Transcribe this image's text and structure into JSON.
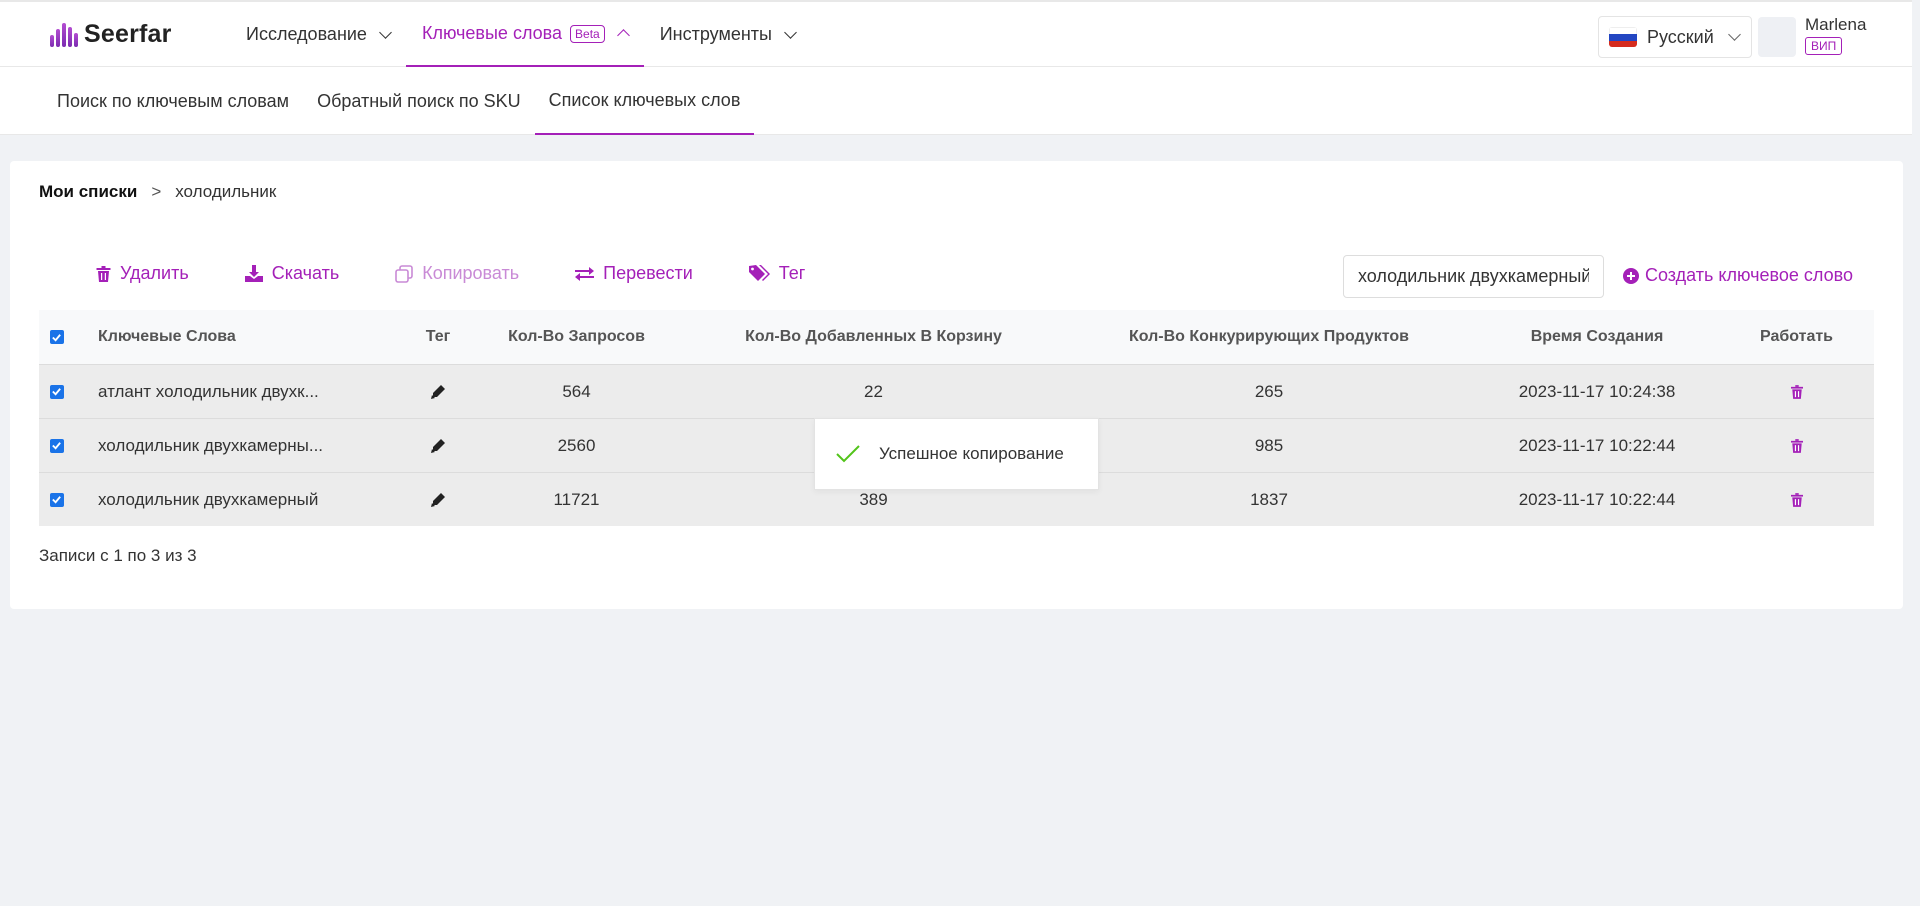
{
  "header": {
    "logo": "Seerfar",
    "nav": [
      {
        "label": "Исследование",
        "badge": "",
        "active": false
      },
      {
        "label": "Ключевые слова",
        "badge": "Beta",
        "active": true
      },
      {
        "label": "Инструменты",
        "badge": "",
        "active": false
      }
    ],
    "language": "Русский",
    "user": {
      "name": "Marlena",
      "level": "ВИП"
    }
  },
  "subnav": {
    "items": [
      {
        "label": "Поиск по ключевым словам",
        "active": false
      },
      {
        "label": "Обратный поиск по SKU",
        "active": false
      },
      {
        "label": "Список ключевых слов",
        "active": true
      }
    ]
  },
  "breadcrumb": {
    "root": "Мои списки",
    "separator": ">",
    "current": "холодильник"
  },
  "toolbar": {
    "delete": "Удалить",
    "download": "Скачать",
    "copy": "Копировать",
    "translate": "Перевести",
    "tag": "Тег",
    "search_value": "холодильник двухкамерный",
    "create": "Создать ключевое слово"
  },
  "table": {
    "headers": {
      "keywords": "Ключевые Слова",
      "tag": "Тег",
      "requests": "Кол-Во Запросов",
      "cart": "Кол-Во Добавленных В Корзину",
      "competitors": "Кол-Во Конкурирующих Продуктов",
      "created": "Время Создания",
      "action": "Работать"
    },
    "rows": [
      {
        "keyword": "атлант холодильник двухк...",
        "requests": "564",
        "cart": "22",
        "competitors": "265",
        "created": "2023-11-17 10:24:38"
      },
      {
        "keyword": "холодильник двухкамерны...",
        "requests": "2560",
        "cart": "",
        "competitors": "985",
        "created": "2023-11-17 10:22:44"
      },
      {
        "keyword": "холодильник двухкамерный",
        "requests": "11721",
        "cart": "389",
        "competitors": "1837",
        "created": "2023-11-17 10:22:44"
      }
    ]
  },
  "footer": {
    "records": "Записи с 1 по 3 из 3"
  },
  "toast": {
    "message": "Успешное копирование"
  },
  "colors": {
    "accent": "#a420b8",
    "checkbox": "#1a73e8",
    "success": "#52c41a"
  }
}
